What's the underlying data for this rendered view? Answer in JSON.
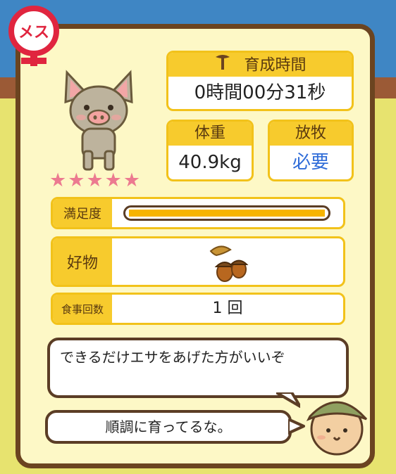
{
  "gender_badge": {
    "text": "メス"
  },
  "pig": {
    "rating_stars": 5,
    "max_stars": 5
  },
  "growth_time": {
    "label": "育成時間",
    "value": "0時間00分31秒"
  },
  "weight": {
    "label": "体重",
    "value": "40.9kg"
  },
  "grazing": {
    "label": "放牧",
    "value": "必要"
  },
  "satisfaction": {
    "label": "満足度",
    "fraction": 1.0
  },
  "favorite": {
    "label": "好物",
    "item_icon": "acorn-icon"
  },
  "meal_count": {
    "label": "食事回数",
    "value": "1 回"
  },
  "dialog": {
    "advice": "できるだけエサをあげた方がいいぞ",
    "comment": "順調に育ってるな。"
  },
  "colors": {
    "frame": "#6b4420",
    "label_yellow": "#f7cb2d",
    "grazing_text": "#2f6cd8",
    "star": "#ec7a90"
  }
}
